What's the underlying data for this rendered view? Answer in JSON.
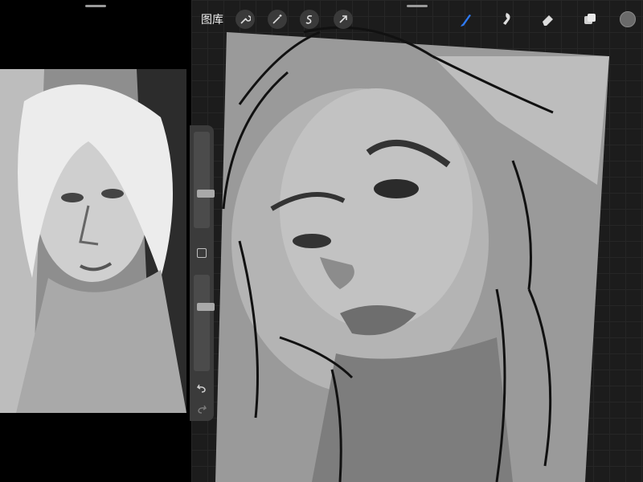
{
  "toolbar": {
    "gallery_label": "图库",
    "left_tools": [
      "wrench-icon",
      "magic-wand-icon",
      "selection-s-icon",
      "transform-arrow-icon"
    ],
    "right_tools": [
      "brush-icon",
      "smudge-icon",
      "eraser-icon",
      "layers-icon"
    ],
    "active_tool": "brush-icon",
    "accent_color": "#2f7bf6",
    "current_color": "#6a6a6a"
  },
  "sidebar": {
    "brush_size_level": 0.35,
    "opacity_level": 0.68,
    "buttons": [
      "modify-square-icon",
      "undo-icon",
      "redo-icon"
    ]
  },
  "reference": {
    "layout": "split-view-left"
  }
}
